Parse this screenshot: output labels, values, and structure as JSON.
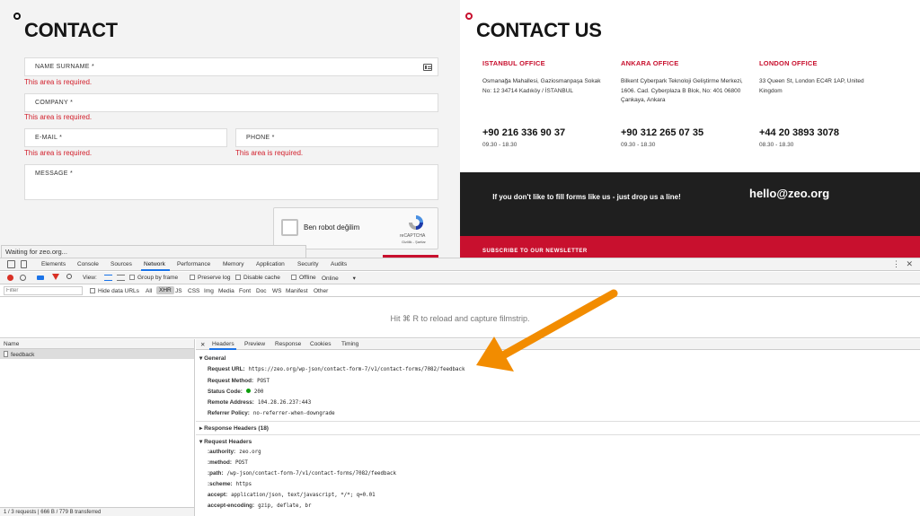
{
  "contact_form": {
    "title": "CONTACT",
    "fields": [
      {
        "label": "NAME SURNAME *",
        "error": "This area is required."
      },
      {
        "label": "COMPANY *",
        "error": "This area is required."
      },
      {
        "label": "E-MAIL *",
        "error": "This area is required."
      },
      {
        "label": "PHONE *",
        "error": "This area is required."
      },
      {
        "label": "MESSAGE *"
      }
    ],
    "captcha": {
      "label": "Ben robot değilim",
      "brand": "reCAPTCHA",
      "terms": "Gizlilik - Şartlar"
    }
  },
  "contact_us": {
    "title": "CONTACT US",
    "offices": [
      {
        "name": "ISTANBUL OFFICE",
        "address": "Osmanağa Mahallesi, Gaziosmanpaşa Sokak No: 12 34714 Kadıköy / İSTANBUL",
        "phone": "+90 216 336 90 37",
        "hours": "09.30 - 18.30"
      },
      {
        "name": "ANKARA OFFICE",
        "address": "Bilkent Cyberpark Teknoloji Geliştirme Merkezi, 1606. Cad. Cyberplaza B Blok, No: 401 06800 Çankaya, Ankara",
        "phone": "+90 312 265 07 35",
        "hours": "09.30 - 18.30"
      },
      {
        "name": "LONDON OFFICE",
        "address": "33 Queen St, London EC4R 1AP, United Kingdom",
        "phone": "+44 20 3893 3078",
        "hours": "08.30 - 18.30"
      }
    ],
    "cta_text": "If you don't like to fill forms like us - just drop us a line!",
    "email": "hello@zeo.org",
    "newsletter": "SUBSCRIBE TO OUR NEWSLETTER"
  },
  "status_bar": "Waiting for zeo.org...",
  "devtools": {
    "tabs": [
      "Elements",
      "Console",
      "Sources",
      "Network",
      "Performance",
      "Memory",
      "Application",
      "Security",
      "Audits"
    ],
    "active_tab": "Network",
    "toolbar": {
      "view": "View:",
      "group_by_frame": "Group by frame",
      "preserve_log": "Preserve log",
      "disable_cache": "Disable cache",
      "offline": "Offline",
      "throttle": "Online"
    },
    "filter": {
      "placeholder": "Filter",
      "hide_data_urls": "Hide data URLs",
      "types": [
        "All",
        "XHR",
        "JS",
        "CSS",
        "Img",
        "Media",
        "Font",
        "Doc",
        "WS",
        "Manifest",
        "Other"
      ],
      "selected_type": "XHR"
    },
    "filmstrip_hint": "Hit ⌘ R to reload and capture filmstrip.",
    "list": {
      "header": "Name",
      "rows": [
        "feedback"
      ],
      "footer": "1 / 3 requests | 666 B / 779 B transferred"
    },
    "detail_tabs": [
      "Headers",
      "Preview",
      "Response",
      "Cookies",
      "Timing"
    ],
    "active_detail_tab": "Headers",
    "general": {
      "title": "General",
      "request_url_label": "Request URL:",
      "request_url": "https://zeo.org/wp-json/contact-form-7/v1/contact-forms/7082/feedback",
      "request_method_label": "Request Method:",
      "request_method": "POST",
      "status_code_label": "Status Code:",
      "status_code": "200",
      "remote_address_label": "Remote Address:",
      "remote_address": "104.28.26.237:443",
      "referrer_policy_label": "Referrer Policy:",
      "referrer_policy": "no-referrer-when-downgrade"
    },
    "response_headers": "Response Headers (18)",
    "request_headers": {
      "title": "Request Headers",
      "rows": [
        {
          "k": ":authority:",
          "v": "zeo.org"
        },
        {
          "k": ":method:",
          "v": "POST"
        },
        {
          "k": ":path:",
          "v": "/wp-json/contact-form-7/v1/contact-forms/7082/feedback"
        },
        {
          "k": ":scheme:",
          "v": "https"
        },
        {
          "k": "accept:",
          "v": "application/json, text/javascript, */*; q=0.01"
        },
        {
          "k": "accept-encoding:",
          "v": "gzip, deflate, br"
        }
      ]
    }
  },
  "colors": {
    "brand_red": "#c8102e",
    "arrow_orange": "#f28c00",
    "devtools_blue": "#1a73e8"
  }
}
